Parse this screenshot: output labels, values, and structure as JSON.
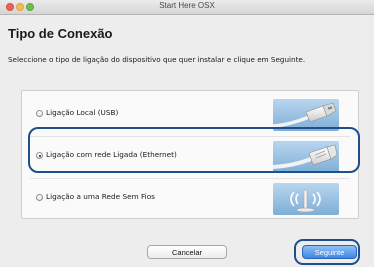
{
  "window": {
    "title": "Start Here OSX"
  },
  "page": {
    "heading": "Tipo de Conexão",
    "instruction": "Seleccione o tipo de ligação do dispositivo que quer instalar e clique em Seguinte."
  },
  "options": [
    {
      "label": "Ligação Local (USB)",
      "selected": false,
      "icon": "usb-cable-icon"
    },
    {
      "label": "Ligação com rede Ligada (Ethernet)",
      "selected": true,
      "icon": "ethernet-cable-icon"
    },
    {
      "label": "Ligação a uma Rede Sem Fios",
      "selected": false,
      "icon": "wireless-access-point-icon"
    }
  ],
  "buttons": {
    "cancel": "Cancelar",
    "next": "Seguinte"
  },
  "colors": {
    "highlight": "#1f4f8a",
    "primary_button": "#3d86e3",
    "image_background": "#8eb8dc"
  }
}
